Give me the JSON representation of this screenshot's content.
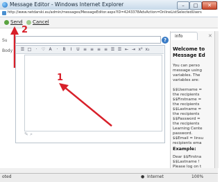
{
  "window": {
    "title": "Message Editor - Windows Internet Explorer",
    "min": "–",
    "max": "□",
    "close": "✕"
  },
  "address": {
    "url": "http://www.netdarski.eu/admin/messages/MessageEditor.aspx?ID=4243378AdvAction=OnlineListSelectedUsers"
  },
  "toolbar": {
    "send_label": "Send",
    "cancel_label": "Cancel"
  },
  "annotations": {
    "marker_1": "1",
    "marker_2": "2",
    "color": "#d8202a"
  },
  "form": {
    "subject_label": "Su",
    "body_label": "Body",
    "help_icon": "?"
  },
  "editor": {
    "toolbar_icons": [
      "☰",
      "□",
      "·",
      "♡",
      "A",
      "·",
      "B",
      "I",
      "U",
      "≡",
      "≡",
      "≡",
      "≡",
      "☰",
      "☰",
      "⇤",
      "⇥",
      "x²",
      "x₂"
    ],
    "footer_icons": "✎  ⌕"
  },
  "info_panel": {
    "tab": "info",
    "close_icon": "✕",
    "heading_1": "Welcome to",
    "heading_2": "Message Ed",
    "lines": [
      "You can perso",
      "message using",
      "variables. The",
      "variables are:",
      "",
      "$$Username =",
      "the recipients",
      "$$Firstname =",
      "the recipients",
      "$$Lastname =",
      "the recipients",
      "$$Password =",
      "the recipients",
      "Learning Cente",
      "password.",
      "$$Email = linsu",
      "recipients ema"
    ],
    "example_heading": "Example:",
    "example_lines": [
      "Dear $$Firstna",
      "$$Lastname !",
      "Please log on t"
    ]
  },
  "status": {
    "left": "oted",
    "zone": "Internet",
    "zoom": "100%"
  }
}
